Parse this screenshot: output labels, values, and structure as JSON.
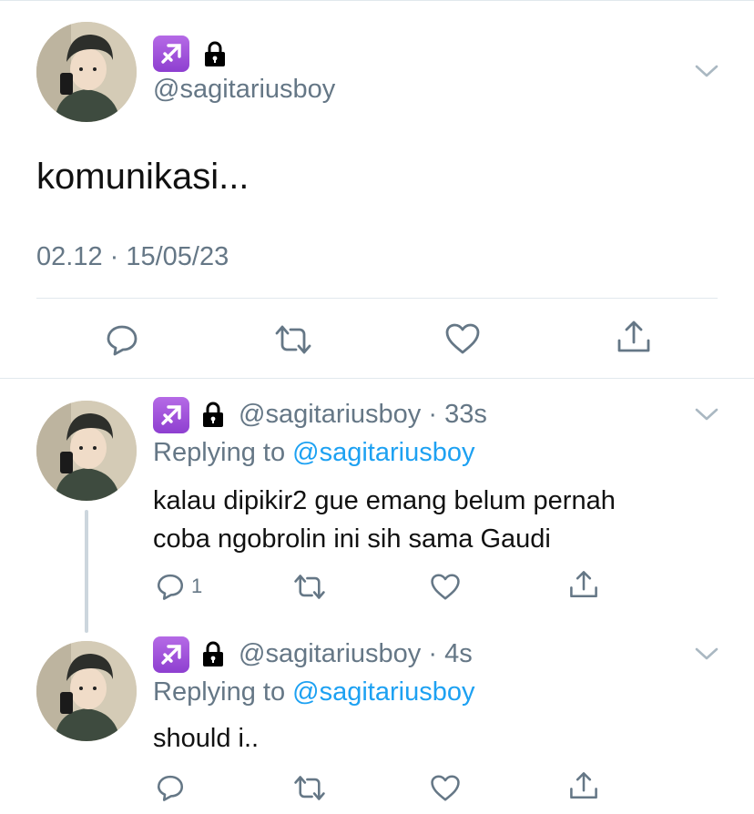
{
  "main_tweet": {
    "handle": "@sagitariusboy",
    "text": "komunikasi...",
    "meta": "02.12 · 15/05/23",
    "sag_icon": "sagittarius-icon",
    "lock_icon": "lock-icon"
  },
  "replies": [
    {
      "handle_time": "@sagitariusboy · 33s",
      "replying_prefix": "Replying to ",
      "replying_handle": "@sagitariusboy",
      "line1": "kalau dipikir2 gue emang belum pernah",
      "line2": "coba ngobrolin ini sih sama Gaudi",
      "reply_count": "1"
    },
    {
      "handle_time": "@sagitariusboy · 4s",
      "replying_prefix": "Replying to ",
      "replying_handle": "@sagitariusboy",
      "line1": "should i..",
      "reply_count": ""
    }
  ],
  "colors": {
    "accent": "#1da1f2",
    "muted": "#657786",
    "divider": "#e1e8ed",
    "sagittarius": "#9b4fdc"
  }
}
